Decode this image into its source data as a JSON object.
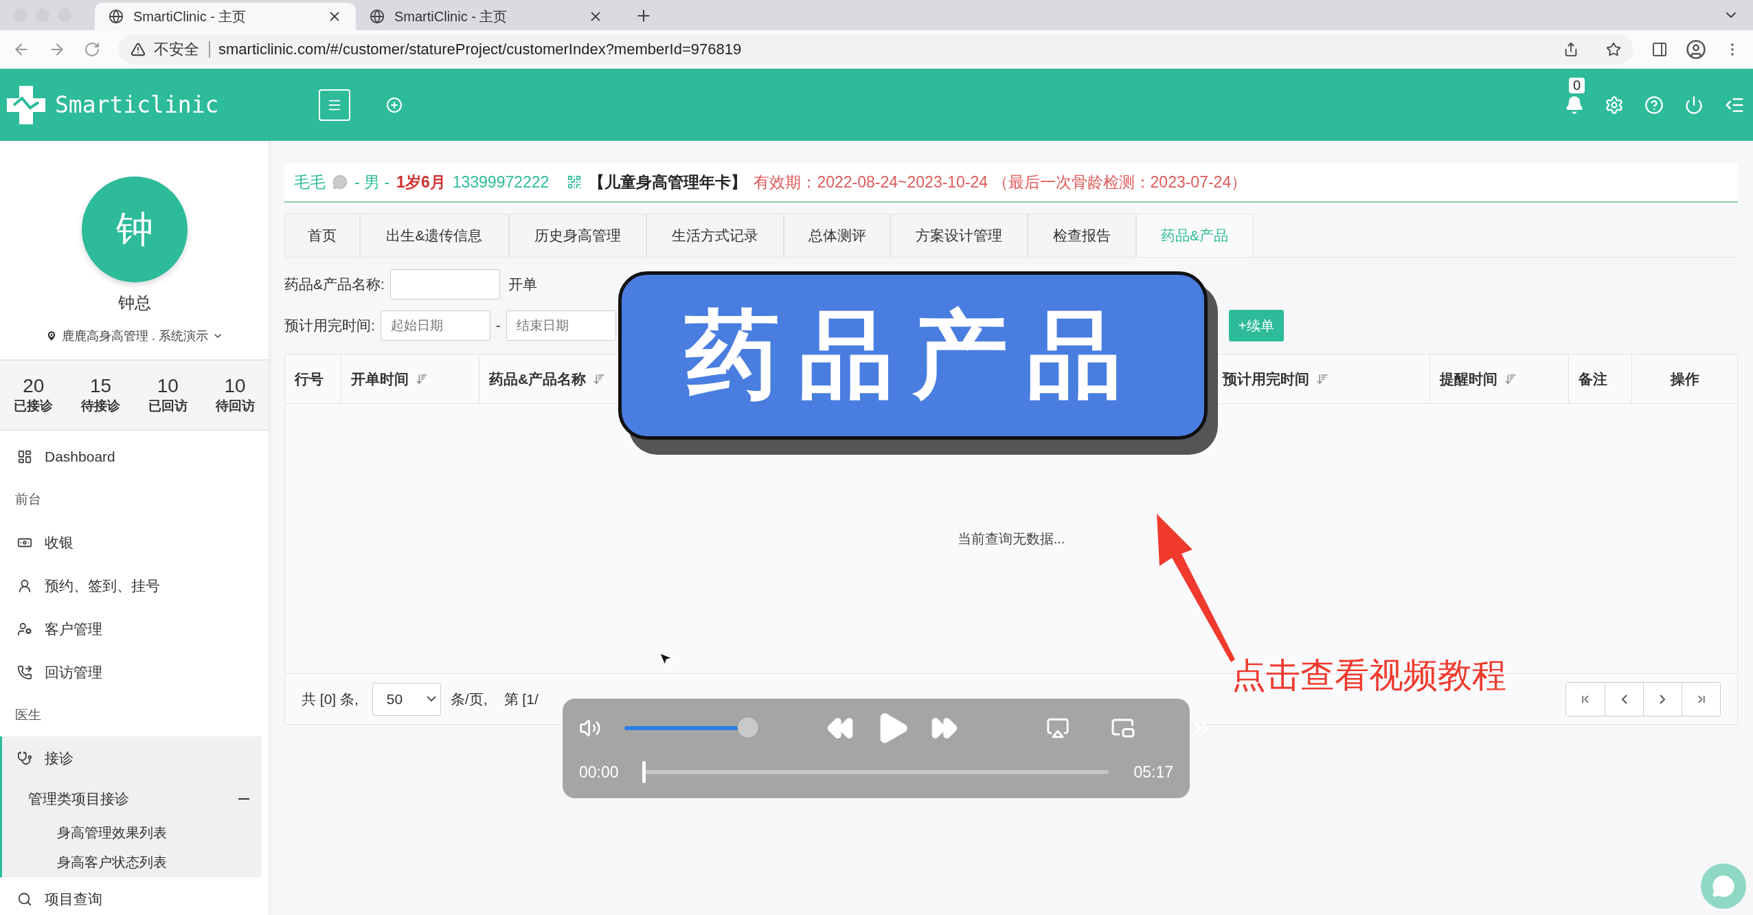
{
  "browser": {
    "tabs": [
      {
        "title": "SmartiClinic - 主页",
        "selected": true
      },
      {
        "title": "SmartiClinic - 主页",
        "selected": false
      }
    ],
    "security_label": "不安全",
    "url": "smarticlinic.com/#/customer/statureProject/customerIndex?memberId=976819"
  },
  "header": {
    "logo_text": "Smarticlinic",
    "notification_count": "0"
  },
  "profile": {
    "avatar_initial": "钟",
    "name": "钟总",
    "location": "鹿鹿高身高管理 . 系统演示"
  },
  "stats": [
    {
      "value": "20",
      "label": "已接诊"
    },
    {
      "value": "15",
      "label": "待接诊"
    },
    {
      "value": "10",
      "label": "已回访"
    },
    {
      "value": "10",
      "label": "待回访"
    }
  ],
  "menu": [
    {
      "kind": "link",
      "label": "Dashboard",
      "selected": false
    },
    {
      "kind": "section",
      "label": "前台"
    },
    {
      "kind": "link",
      "label": "收银",
      "selected": false
    },
    {
      "kind": "link",
      "label": "预约、签到、挂号",
      "selected": false
    },
    {
      "kind": "link",
      "label": "客户管理",
      "selected": false
    },
    {
      "kind": "link",
      "label": "回访管理",
      "selected": false
    },
    {
      "kind": "section",
      "label": "医生"
    },
    {
      "kind": "link",
      "label": "接诊",
      "selected": true,
      "children": [
        {
          "label": "管理类项目接诊",
          "expanded": true,
          "children": [
            {
              "label": "身高管理效果列表"
            },
            {
              "label": "身高客户状态列表"
            }
          ]
        }
      ]
    },
    {
      "kind": "link",
      "label": "项目查询",
      "selected": false
    }
  ],
  "patient": {
    "name": "毛毛",
    "gender": "- 男 -",
    "age": "1岁6月",
    "phone": "13399972222",
    "card": "【儿童身高管理年卡】",
    "validity": "有效期：2022-08-24~2023-10-24 （最后一次骨龄检测：2023-07-24）"
  },
  "tabs": [
    {
      "label": "首页",
      "selected": false
    },
    {
      "label": "出生&遗传信息",
      "selected": false
    },
    {
      "label": "历史身高管理",
      "selected": false
    },
    {
      "label": "生活方式记录",
      "selected": false
    },
    {
      "label": "总体测评",
      "selected": false
    },
    {
      "label": "方案设计管理",
      "selected": false
    },
    {
      "label": "检查报告",
      "selected": false
    },
    {
      "label": "药品&产品",
      "selected": true
    }
  ],
  "filters": {
    "name_label": "药品&产品名称:",
    "order_label": "开单",
    "date_label": "预计用完时间:",
    "start_placeholder": "起始日期",
    "separator": "-",
    "end_placeholder": "结束日期",
    "renew_button": "+续单"
  },
  "table": {
    "columns": [
      {
        "label": "行号",
        "sortable": false
      },
      {
        "label": "开单时间",
        "sortable": true
      },
      {
        "label": "药品&产品名称",
        "sortable": true
      },
      {
        "label": "预计用完时间",
        "sortable": true
      },
      {
        "label": "提醒时间",
        "sortable": true
      },
      {
        "label": "备注",
        "sortable": false
      },
      {
        "label": "操作",
        "sortable": false
      }
    ],
    "empty_message": "当前查询无数据..."
  },
  "pagination": {
    "total": "共 [0] 条,",
    "page_size": "50",
    "per_page": "条/页,",
    "page": "第 [1/"
  },
  "overlay": {
    "title_card": "药品产品",
    "hint": "点击查看视频教程"
  },
  "player": {
    "volume": {
      "level": 1
    },
    "elapsed": "00:00",
    "progress": {
      "level": 0
    },
    "duration": "05:17"
  }
}
